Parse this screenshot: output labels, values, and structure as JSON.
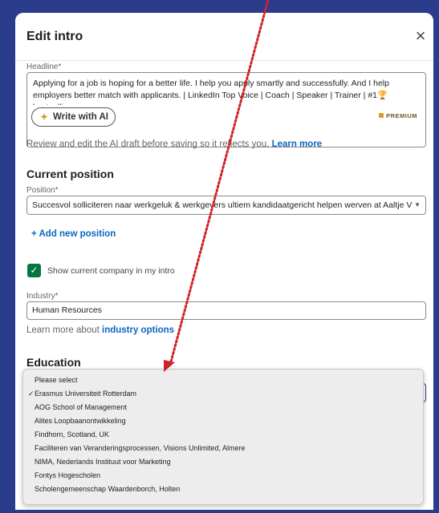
{
  "modal": {
    "title": "Edit intro",
    "close_icon": "close-icon"
  },
  "headline": {
    "label": "Headline*",
    "value": "Applying for a job is hoping for a better life. I help you apply smartly and successfully. And I help employers better match with applicants. | LinkedIn Top Voice | Coach | Speaker | Trainer | #1🏆 bestselling",
    "write_ai_label": "Write with AI",
    "premium_label": "PREMIUM",
    "review_text": "Review and edit the AI draft before saving so it reflects you.",
    "learn_more": "Learn more"
  },
  "current_position": {
    "title": "Current position",
    "position_label": "Position*",
    "position_value": "Succesvol solliciteren naar werkgeluk & werkgevers ultiem kandidaatgericht helpen werven at Aaltje V",
    "add_new": "+ Add new position",
    "show_company_label": "Show current company in my intro",
    "show_company_checked": true,
    "industry_label": "Industry*",
    "industry_value": "Human Resources",
    "industry_help_prefix": "Learn more about",
    "industry_help_link": "industry options"
  },
  "education": {
    "title": "Education",
    "options": [
      "Please select",
      "Erasmus Universiteit Rotterdam",
      "AOG School of Management",
      "Alites Loopbaanontwikkeling",
      "Findhorn, Scotland, UK",
      "Faciliteren van Veranderingsprocessen, Visions Unlimited, Almere",
      "NIMA, Nederlands Instituut voor Marketing",
      "Fontys Hogescholen",
      "Scholengemeenschap Waardenborch, Holten"
    ],
    "selected": "Erasmus Universiteit Rotterdam"
  },
  "colors": {
    "frame": "#2b3c8c",
    "link": "#0a66c2",
    "checkbox": "#057642",
    "arrow": "#d1232a"
  }
}
